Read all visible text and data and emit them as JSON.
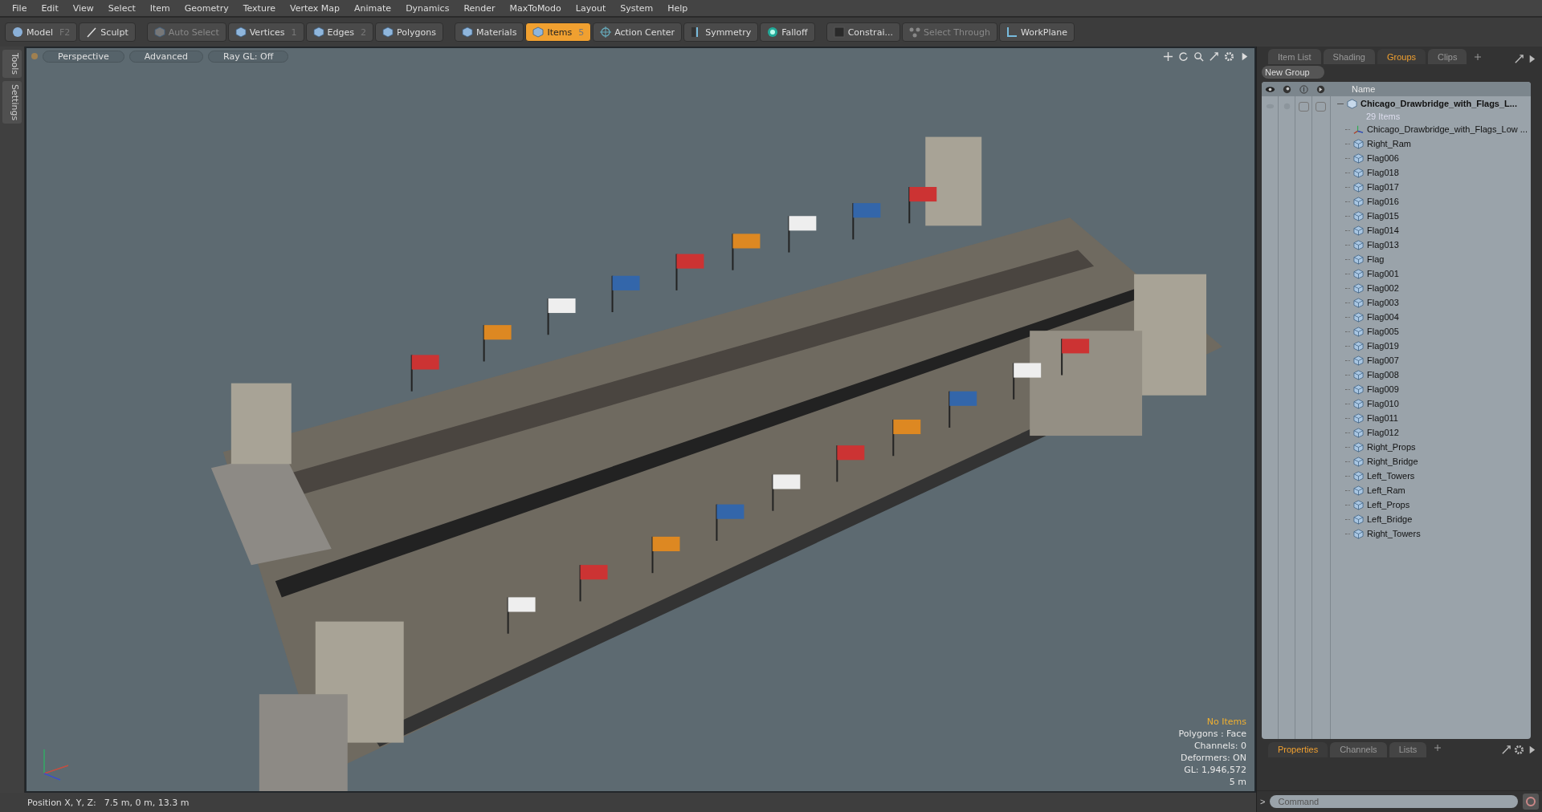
{
  "menu": [
    "File",
    "Edit",
    "View",
    "Select",
    "Item",
    "Geometry",
    "Texture",
    "Vertex Map",
    "Animate",
    "Dynamics",
    "Render",
    "MaxToModo",
    "Layout",
    "System",
    "Help"
  ],
  "toolbar": [
    {
      "label": "Model",
      "shortcut": "F2",
      "selected": false,
      "disabled": false
    },
    {
      "label": "Sculpt",
      "selected": false,
      "disabled": false
    },
    {
      "label": "Auto Select",
      "selected": false,
      "disabled": true
    },
    {
      "label": "Vertices",
      "shortcut": "1",
      "selected": false,
      "disabled": false
    },
    {
      "label": "Edges",
      "shortcut": "2",
      "selected": false,
      "disabled": false
    },
    {
      "label": "Polygons",
      "selected": false,
      "disabled": false
    },
    {
      "label": "Materials",
      "selected": false,
      "disabled": false
    },
    {
      "label": "Items",
      "shortcut": "5",
      "selected": true,
      "disabled": false
    },
    {
      "label": "Action Center",
      "selected": false,
      "disabled": false
    },
    {
      "label": "Symmetry",
      "selected": false,
      "disabled": false
    },
    {
      "label": "Falloff",
      "selected": false,
      "disabled": false
    },
    {
      "label": "Constrai...",
      "selected": false,
      "disabled": false
    },
    {
      "label": "Select Through",
      "selected": false,
      "disabled": true
    },
    {
      "label": "WorkPlane",
      "selected": false,
      "disabled": false
    }
  ],
  "side_tabs": [
    "Tools",
    "Settings"
  ],
  "viewport": {
    "tabs": [
      "Perspective",
      "Advanced",
      "Ray GL: Off"
    ],
    "info": [
      {
        "text": "No Items",
        "kind": "highlight"
      },
      {
        "text": "Polygons : Face",
        "kind": "plain"
      },
      {
        "text": "Channels: 0",
        "kind": "plain"
      },
      {
        "text": "Deformers: ON",
        "kind": "plain"
      },
      {
        "text": "GL: 1,946,572",
        "kind": "plain"
      },
      {
        "text": "5 m",
        "kind": "plain"
      }
    ]
  },
  "status_bar": {
    "label": "Position X, Y, Z:",
    "value": "7.5 m, 0 m, 13.3 m"
  },
  "panel": {
    "tabs": [
      {
        "label": "Item List",
        "selected": false
      },
      {
        "label": "Shading",
        "selected": false
      },
      {
        "label": "Groups",
        "selected": true
      },
      {
        "label": "Clips",
        "selected": false
      }
    ],
    "new_group": "New Group",
    "name_column": "Name",
    "root": {
      "name": "Chicago_Drawbridge_with_Flags_L...",
      "count": "29 Items",
      "expanded": true,
      "toggles": [
        {
          "on": false
        },
        {
          "on": false
        }
      ],
      "children": [
        {
          "name": "Chicago_Drawbridge_with_Flags_Low ...",
          "kind": "locator"
        },
        {
          "name": "Right_Ram",
          "kind": "mesh"
        },
        {
          "name": "Flag006",
          "kind": "mesh"
        },
        {
          "name": "Flag018",
          "kind": "mesh"
        },
        {
          "name": "Flag017",
          "kind": "mesh"
        },
        {
          "name": "Flag016",
          "kind": "mesh"
        },
        {
          "name": "Flag015",
          "kind": "mesh"
        },
        {
          "name": "Flag014",
          "kind": "mesh"
        },
        {
          "name": "Flag013",
          "kind": "mesh"
        },
        {
          "name": "Flag",
          "kind": "mesh"
        },
        {
          "name": "Flag001",
          "kind": "mesh"
        },
        {
          "name": "Flag002",
          "kind": "mesh"
        },
        {
          "name": "Flag003",
          "kind": "mesh"
        },
        {
          "name": "Flag004",
          "kind": "mesh"
        },
        {
          "name": "Flag005",
          "kind": "mesh"
        },
        {
          "name": "Flag019",
          "kind": "mesh"
        },
        {
          "name": "Flag007",
          "kind": "mesh"
        },
        {
          "name": "Flag008",
          "kind": "mesh"
        },
        {
          "name": "Flag009",
          "kind": "mesh"
        },
        {
          "name": "Flag010",
          "kind": "mesh"
        },
        {
          "name": "Flag011",
          "kind": "mesh"
        },
        {
          "name": "Flag012",
          "kind": "mesh"
        },
        {
          "name": "Right_Props",
          "kind": "mesh"
        },
        {
          "name": "Right_Bridge",
          "kind": "mesh"
        },
        {
          "name": "Left_Towers",
          "kind": "mesh"
        },
        {
          "name": "Left_Ram",
          "kind": "mesh"
        },
        {
          "name": "Left_Props",
          "kind": "mesh"
        },
        {
          "name": "Left_Bridge",
          "kind": "mesh"
        },
        {
          "name": "Right_Towers",
          "kind": "mesh"
        }
      ]
    },
    "bottom_tabs": [
      {
        "label": "Properties",
        "selected": true
      },
      {
        "label": "Channels",
        "selected": false
      },
      {
        "label": "Lists",
        "selected": false
      }
    ],
    "command": {
      "prompt": ">",
      "placeholder": "Command"
    }
  }
}
